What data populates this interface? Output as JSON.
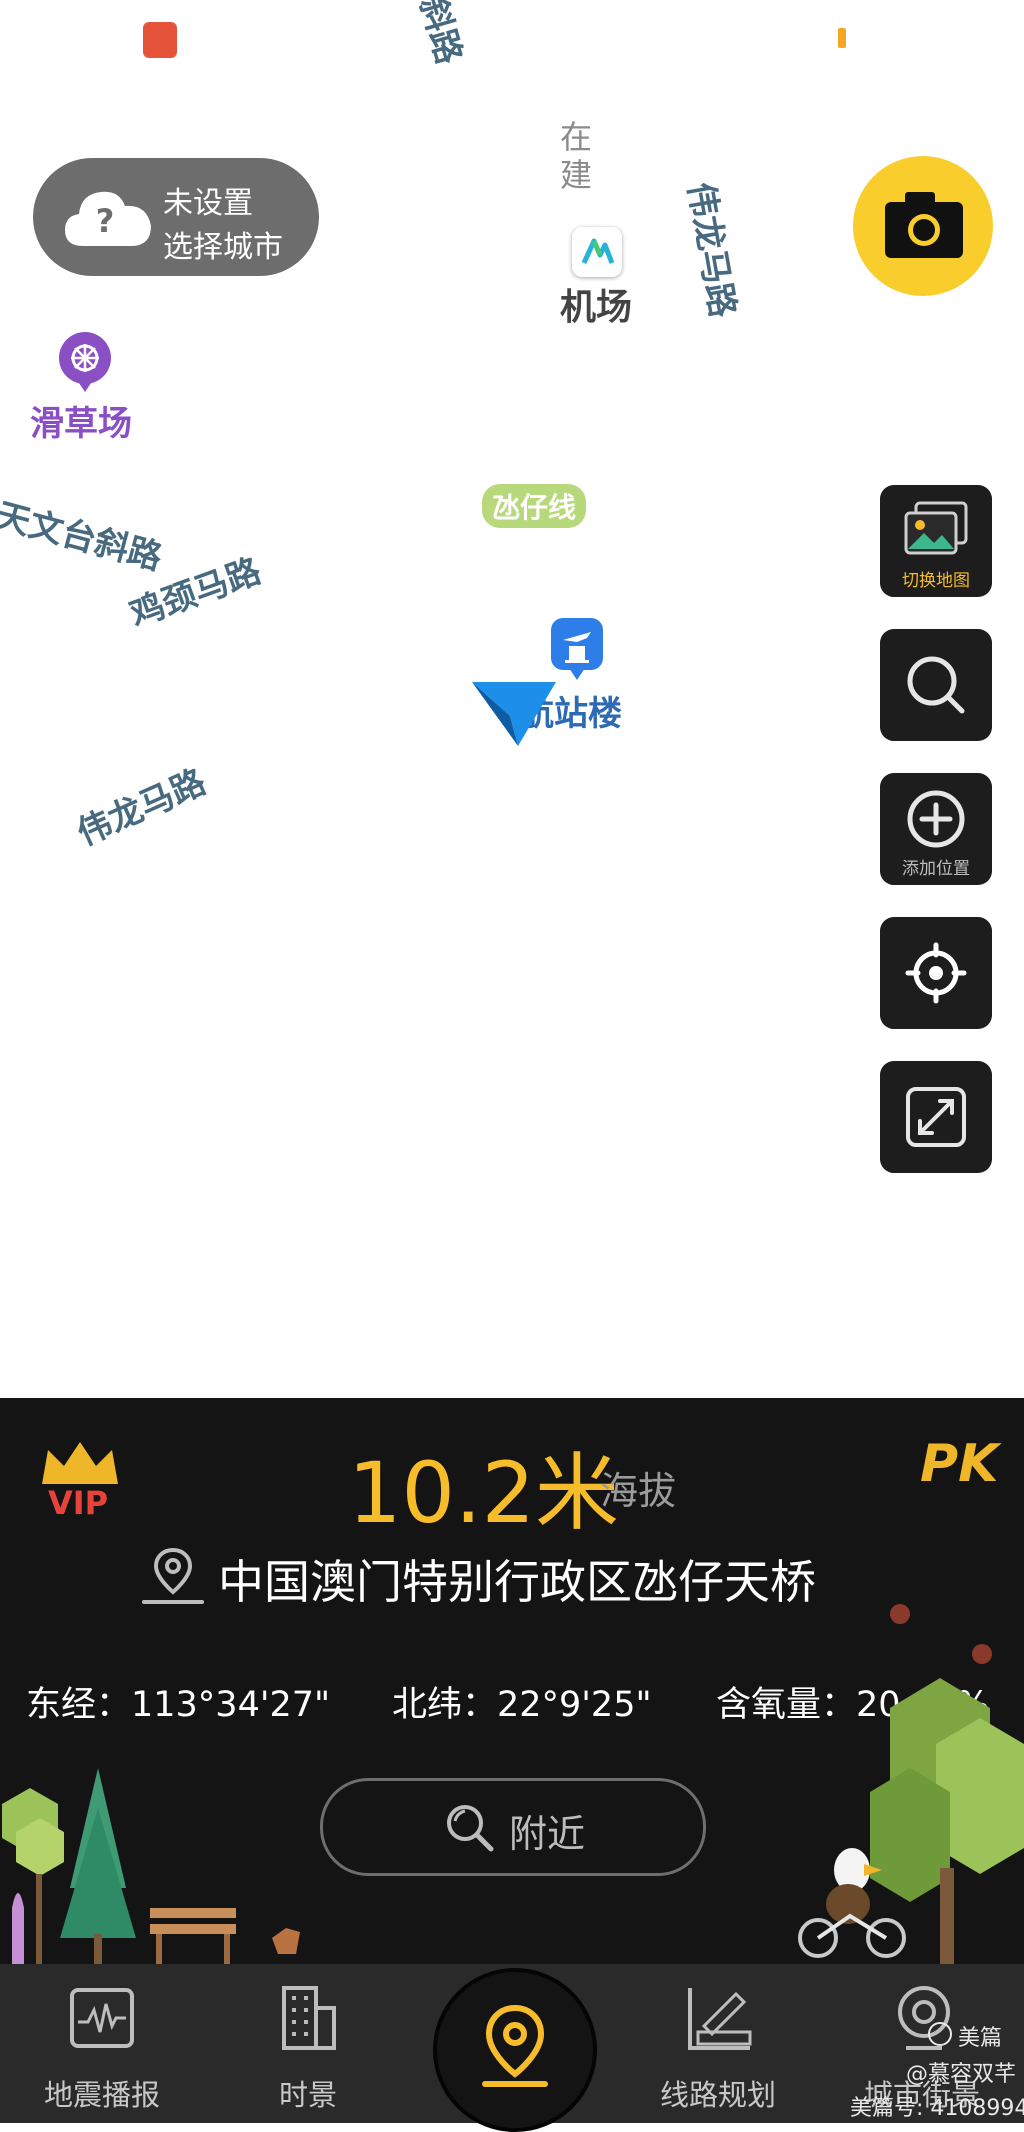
{
  "map": {
    "roads": [
      {
        "name": "斜路"
      },
      {
        "name": "伟龙马路"
      },
      {
        "name": "天文台斜路"
      },
      {
        "name": "鸡颈马路"
      },
      {
        "name": "伟龙马路"
      }
    ],
    "construction_label": "在建",
    "airport_label": "机场",
    "grass_label": "滑草场",
    "line_label": "氹仔线",
    "terminal_label": "航站楼",
    "city_pill": {
      "line1": "未设置",
      "line2": "选择城市"
    },
    "buttons": {
      "switch_map": "切换地图",
      "add_location": "添加位置"
    }
  },
  "info": {
    "altitude": "10.2米",
    "altitude_label": "海拔",
    "vip": "VIP",
    "pk": "PK",
    "address": "中国澳门特别行政区氹仔天桥",
    "longitude": "东经：113°34'27\"",
    "latitude": "北纬：22°9'25\"",
    "oxygen": "含氧量：20.93%",
    "nearby": "附近"
  },
  "tabs": [
    {
      "label": "地震播报",
      "icon": "seismograph-icon"
    },
    {
      "label": "时景",
      "icon": "building-icon"
    },
    {
      "label": "",
      "icon": "location-pin-icon"
    },
    {
      "label": "线路规划",
      "icon": "route-ruler-icon"
    },
    {
      "label": "城市街景",
      "icon": "street-view-icon"
    }
  ],
  "watermark": {
    "brand": "美篇",
    "author": "@慕容双芊",
    "id": "美篇号: 4108994"
  },
  "colors": {
    "accent": "#f6bc2a",
    "panel": "#141414",
    "road": "#486a80",
    "poi_purple": "#8a4fc4",
    "poi_blue": "#2d7ee8"
  }
}
